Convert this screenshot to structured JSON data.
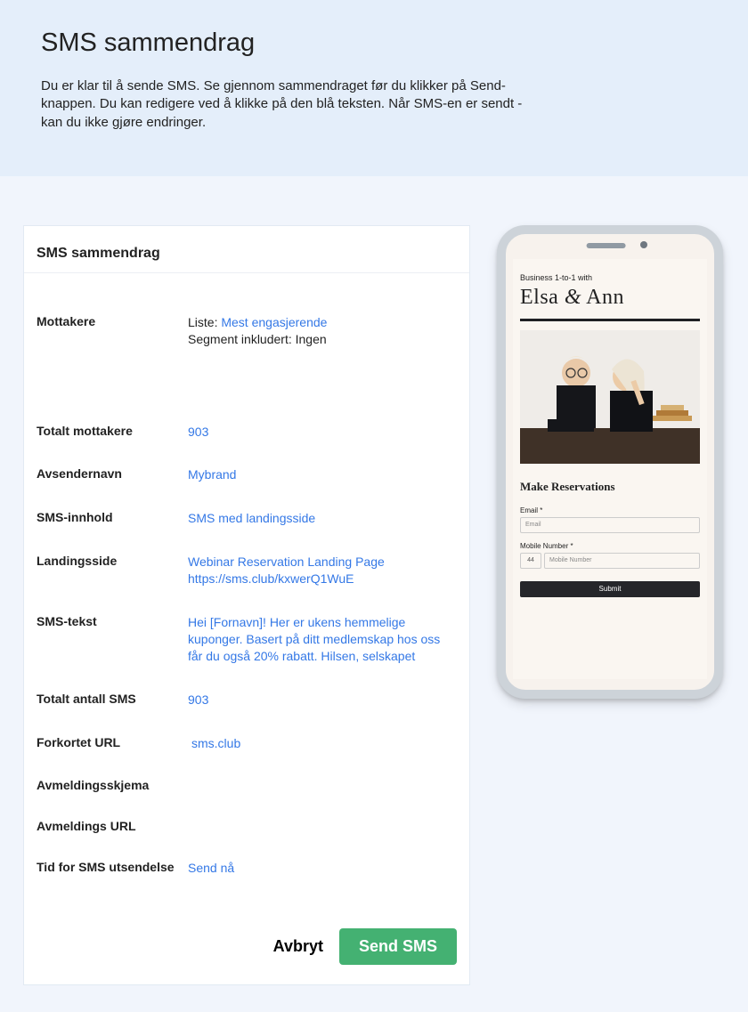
{
  "header": {
    "title": "SMS sammendrag",
    "subtitle": "Du er klar til å sende SMS. Se gjennom sammendraget før du klikker på Send-knappen. Du kan redigere ved å klikke på den blå teksten. Når SMS-en er sendt - kan du ikke gjøre endringer."
  },
  "card": {
    "title": "SMS sammendrag",
    "rows": {
      "recipients": {
        "label": "Mottakere",
        "list_prefix": "Liste: ",
        "list_name": "Mest engasjerende",
        "segment": "Segment inkludert: Ingen"
      },
      "total_recipients": {
        "label": "Totalt mottakere",
        "value": "903"
      },
      "sender": {
        "label": "Avsendernavn",
        "value": "Mybrand"
      },
      "content": {
        "label": "SMS-innhold",
        "value": "SMS med landingsside"
      },
      "landing": {
        "label": "Landingsside",
        "line1": "Webinar Reservation Landing Page",
        "line2": "https://sms.club/kxwerQ1WuE"
      },
      "text": {
        "label": "SMS-tekst",
        "value": "Hei [Fornavn]! Her er ukens hemmelige kuponger. Basert på ditt medlemskap hos oss får du også 20% rabatt. Hilsen, selskapet"
      },
      "total_sms": {
        "label": "Totalt antall SMS",
        "value": "903"
      },
      "short_url": {
        "label": "Forkortet URL",
        "value": "sms.club"
      },
      "unsub_form": {
        "label": "Avmeldingsskjema",
        "value": ""
      },
      "unsub_url": {
        "label": "Avmeldings URL",
        "value": ""
      },
      "send_time": {
        "label": "Tid for SMS utsendelse",
        "value": "Send nå"
      }
    },
    "actions": {
      "cancel": "Avbryt",
      "send": "Send SMS"
    }
  },
  "preview": {
    "small": "Business 1-to-1 with",
    "brand": {
      "a": "Elsa ",
      "amp": "&",
      "b": " Ann"
    },
    "reservations": "Make Reservations",
    "email_label": "Email *",
    "email_placeholder": "Email",
    "mobile_label": "Mobile Number *",
    "mobile_cc": "44",
    "mobile_placeholder": "Mobile Number",
    "submit": "Submit"
  }
}
